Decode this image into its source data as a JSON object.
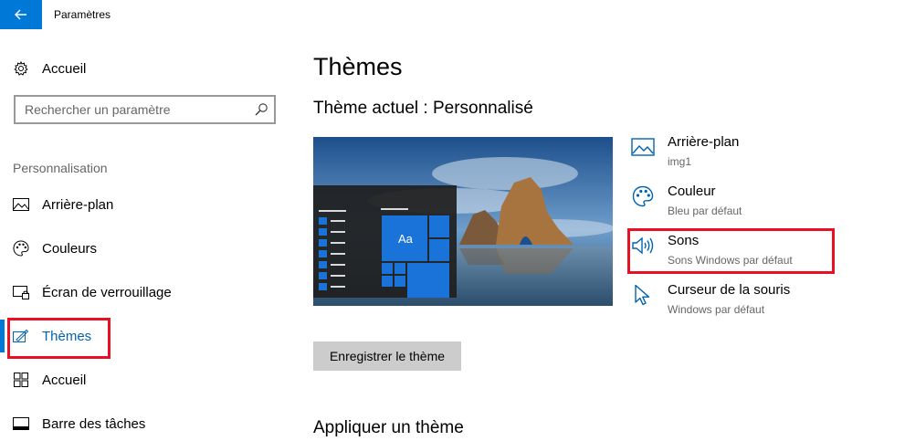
{
  "app": {
    "title": "Paramètres"
  },
  "sidebar": {
    "home_label": "Accueil",
    "search_placeholder": "Rechercher un paramètre",
    "section_label": "Personnalisation",
    "items": [
      {
        "label": "Arrière-plan",
        "icon": "picture-icon"
      },
      {
        "label": "Couleurs",
        "icon": "palette-icon"
      },
      {
        "label": "Écran de verrouillage",
        "icon": "lock-screen-icon"
      },
      {
        "label": "Thèmes",
        "icon": "brush-icon",
        "selected": true
      },
      {
        "label": "Accueil",
        "icon": "start-icon"
      },
      {
        "label": "Barre des tâches",
        "icon": "taskbar-icon"
      }
    ]
  },
  "main": {
    "title": "Thèmes",
    "current_theme": "Thème actuel : Personnalisé",
    "preview_tile_label": "Aa",
    "links": [
      {
        "title": "Arrière-plan",
        "subtitle": "img1",
        "icon": "picture-icon"
      },
      {
        "title": "Couleur",
        "subtitle": "Bleu par défaut",
        "icon": "palette-icon"
      },
      {
        "title": "Sons",
        "subtitle": "Sons Windows par défaut",
        "icon": "speaker-icon"
      },
      {
        "title": "Curseur de la souris",
        "subtitle": "Windows par défaut",
        "icon": "mouse-cursor-icon"
      }
    ],
    "save_button": "Enregistrer le thème",
    "apply_section": "Appliquer un thème"
  },
  "colors": {
    "accent": "#0078d7",
    "highlight": "#e81123",
    "selected_text": "#0063b1"
  }
}
